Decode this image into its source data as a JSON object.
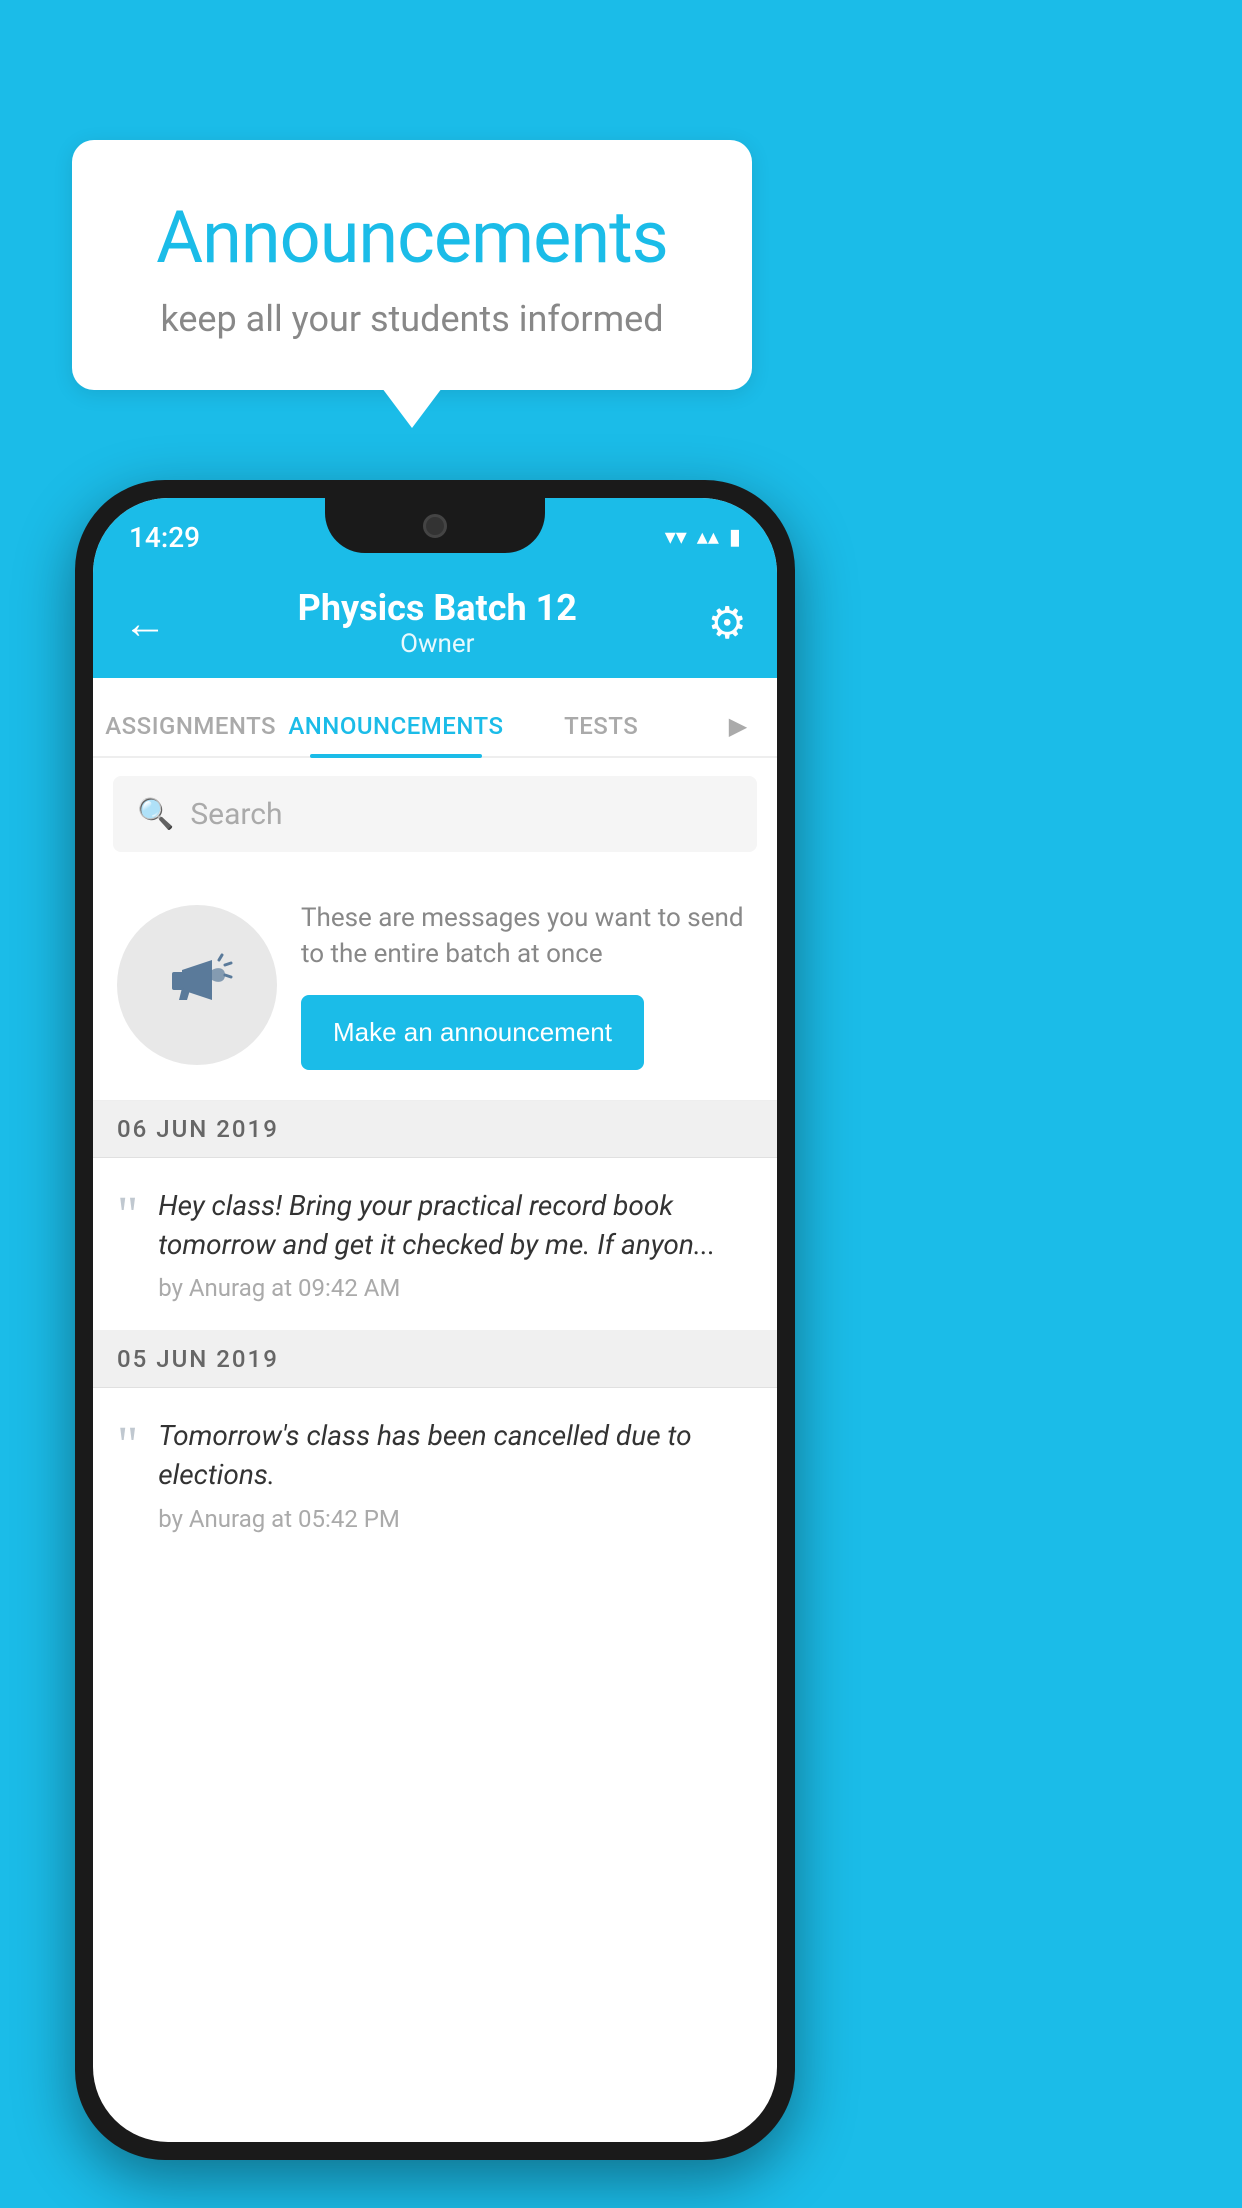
{
  "page": {
    "background_color": "#1BBCE8"
  },
  "speech_bubble": {
    "title": "Announcements",
    "subtitle": "keep all your students informed"
  },
  "status_bar": {
    "time": "14:29",
    "wifi": "▾",
    "signal": "▴▴",
    "battery": "▮"
  },
  "app_bar": {
    "back_label": "←",
    "title": "Physics Batch 12",
    "subtitle": "Owner",
    "gear_label": "⚙"
  },
  "tabs": [
    {
      "label": "ASSIGNMENTS",
      "active": false
    },
    {
      "label": "ANNOUNCEMENTS",
      "active": true
    },
    {
      "label": "TESTS",
      "active": false
    }
  ],
  "search": {
    "placeholder": "Search"
  },
  "promo": {
    "description": "These are messages you want to send to the entire batch at once",
    "button_label": "Make an announcement"
  },
  "announcements": [
    {
      "date": "06  JUN  2019",
      "message": "Hey class! Bring your practical record book tomorrow and get it checked by me. If anyon...",
      "meta": "by Anurag at 09:42 AM"
    },
    {
      "date": "05  JUN  2019",
      "message": "Tomorrow's class has been cancelled due to elections.",
      "meta": "by Anurag at 05:42 PM"
    }
  ]
}
